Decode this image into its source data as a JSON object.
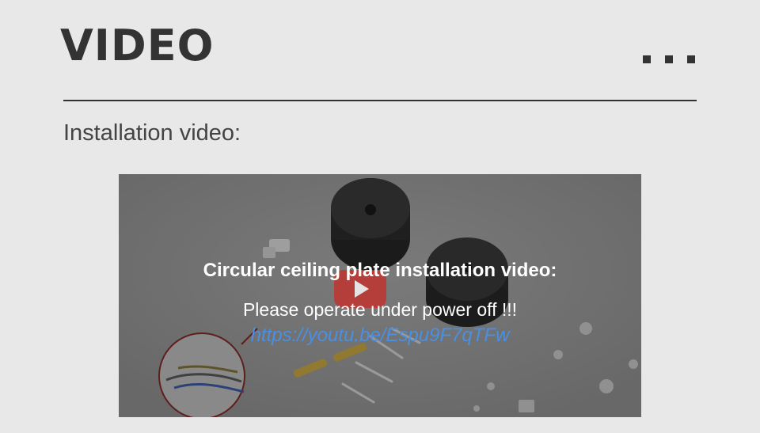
{
  "header": {
    "title": "VIDEO",
    "more_icon": "more-dots-icon"
  },
  "section": {
    "heading": "Installation video:"
  },
  "video": {
    "title": "Circular ceiling plate installation video:",
    "note": "Please operate under power off !!!",
    "link": "https://youtu.be/Espu9F7qTFw",
    "play_icon": "play-icon"
  },
  "colors": {
    "background": "#e8e8e8",
    "title_text": "#333333",
    "link": "#4a90e2",
    "play_button": "#c4302b"
  }
}
